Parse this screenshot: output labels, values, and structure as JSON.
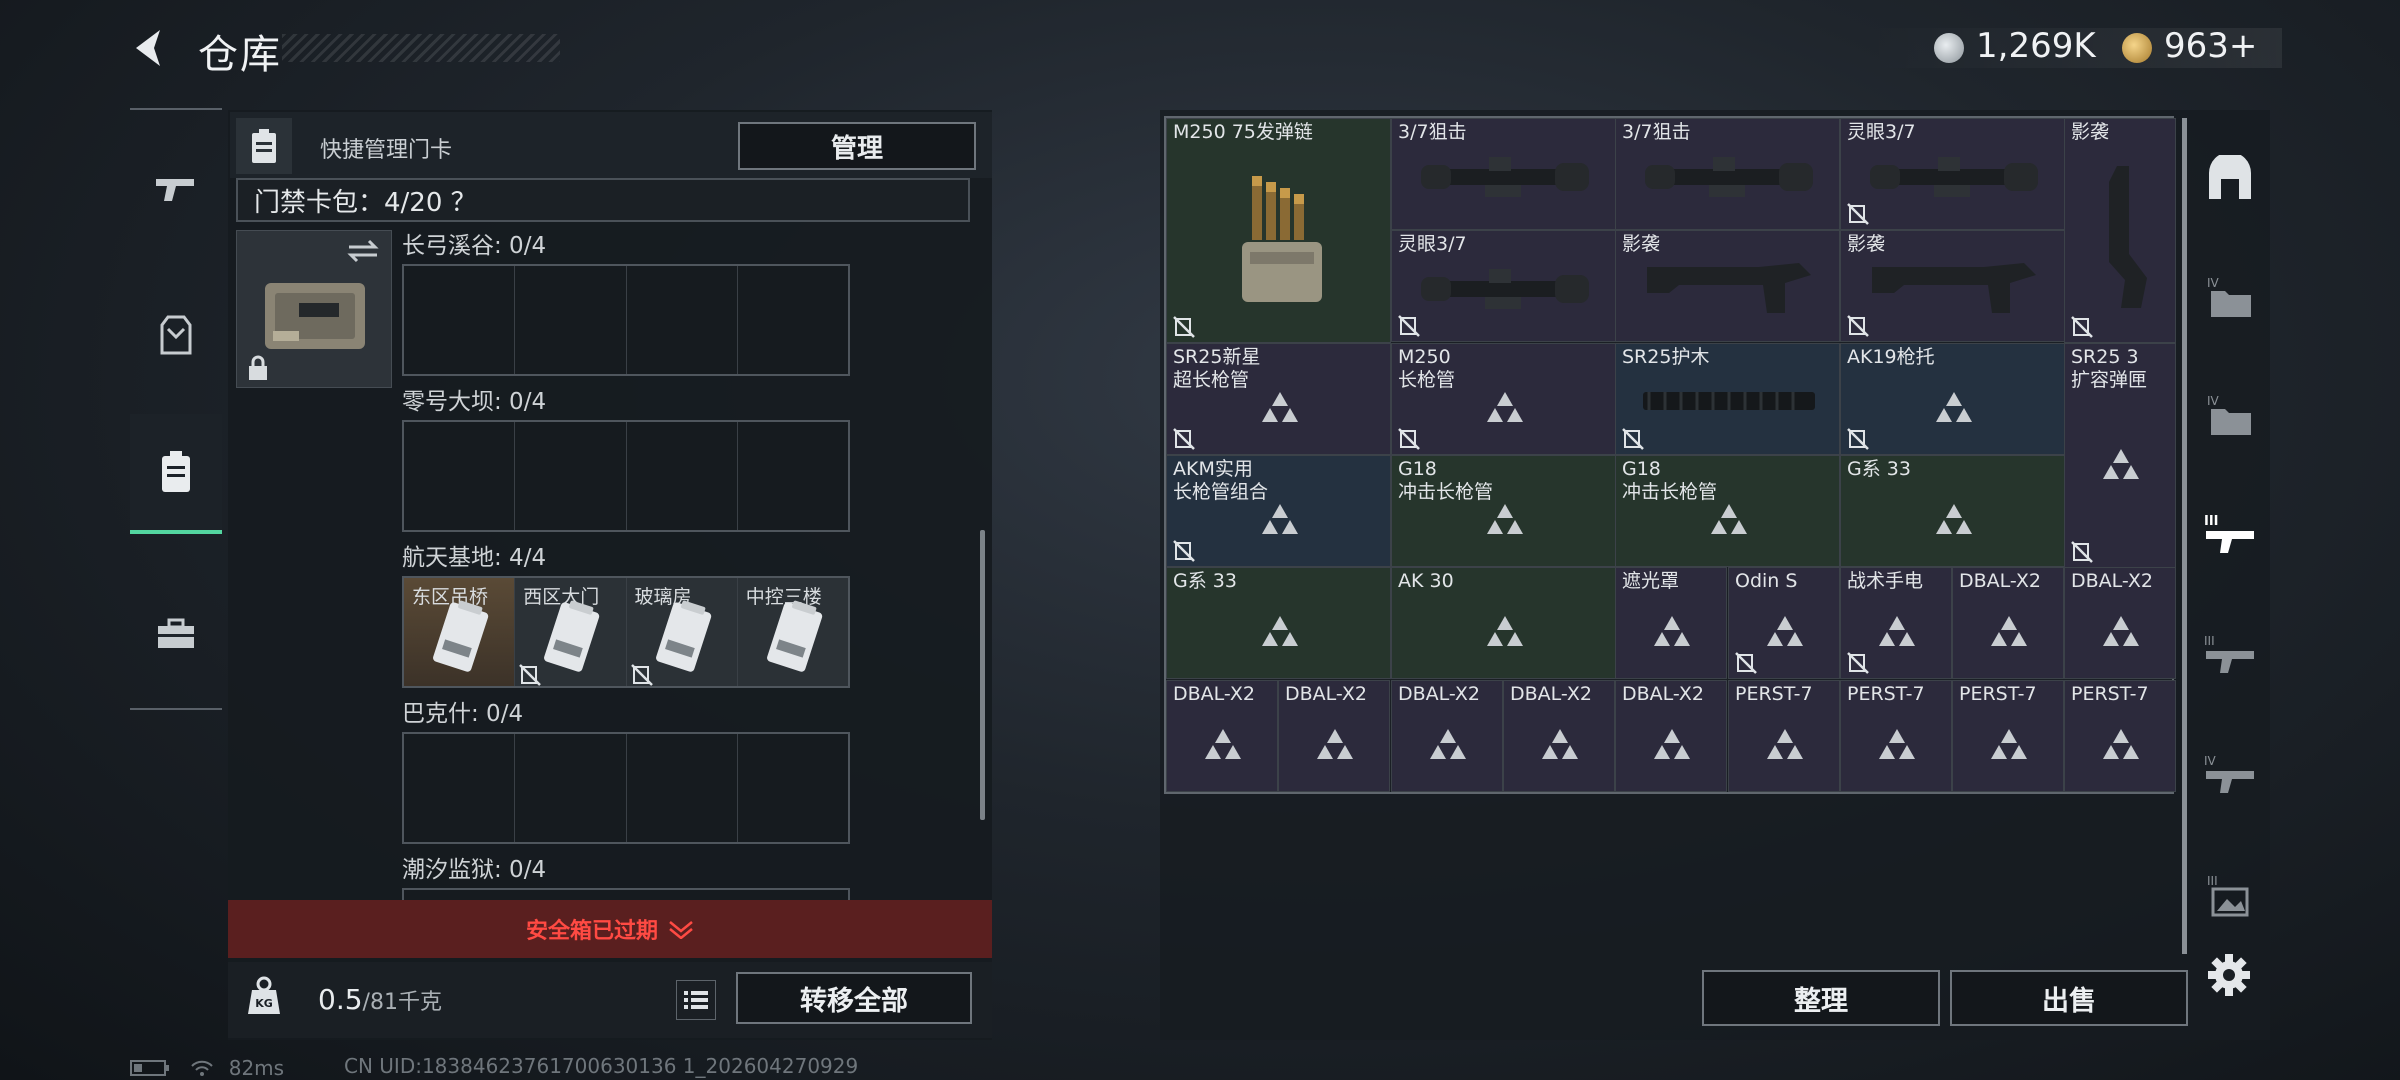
{
  "header": {
    "title": "仓库"
  },
  "currency": [
    {
      "icon": "silver-coin-icon",
      "value": "1,269K"
    },
    {
      "icon": "gold-coin-icon",
      "value": "963+"
    }
  ],
  "left_tabs": [
    {
      "icon": "gun-icon",
      "active": false
    },
    {
      "icon": "armor-icon",
      "active": false
    },
    {
      "icon": "keycard-icon",
      "active": true
    },
    {
      "icon": "toolbox-icon",
      "active": false
    }
  ],
  "keycard_panel": {
    "quick_label": "快捷管理门卡",
    "manage_label": "管理",
    "pack_label": "门禁卡包：4/20 ？",
    "regions": [
      {
        "label": "长弓溪谷: 0/4",
        "cards": []
      },
      {
        "label": "零号大坝: 0/4",
        "cards": []
      },
      {
        "label": "航天基地: 4/4",
        "cards": [
          "东区吊桥",
          "西区大门",
          "玻璃房",
          "中控三楼"
        ]
      },
      {
        "label": "巴克什: 0/4",
        "cards": []
      },
      {
        "label": "潮汐监狱: 0/4",
        "cards": []
      }
    ],
    "expired_label": "安全箱已过期",
    "weight_value": "0.5",
    "weight_max": "/81千克",
    "transfer_label": "转移全部"
  },
  "stash_items": [
    {
      "name": "M250 75发弹链"
    },
    {
      "name": "3/7狙击"
    },
    {
      "name": "3/7狙击"
    },
    {
      "name": "灵眼3/7"
    },
    {
      "name": "影袭"
    },
    {
      "name": "灵眼3/7"
    },
    {
      "name": "影袭"
    },
    {
      "name": "影袭"
    },
    {
      "name": "SR25新星\n超长枪管"
    },
    {
      "name": "M250\n长枪管"
    },
    {
      "name": "SR25护木"
    },
    {
      "name": "AK19枪托"
    },
    {
      "name": "SR25 3\n扩容弹匣"
    },
    {
      "name": "AKM实用\n长枪管组合"
    },
    {
      "name": "G18\n冲击长枪管"
    },
    {
      "name": "G18\n冲击长枪管"
    },
    {
      "name": "G系 33"
    },
    {
      "name": "G系 33"
    },
    {
      "name": "AK 30"
    },
    {
      "name": "遮光罩"
    },
    {
      "name": "Odin S"
    },
    {
      "name": "战术手电"
    },
    {
      "name": "DBAL-X2"
    },
    {
      "name": "DBAL-X2"
    },
    {
      "name": "DBAL-X2"
    },
    {
      "name": "DBAL-X2"
    },
    {
      "name": "DBAL-X2"
    },
    {
      "name": "DBAL-X2"
    },
    {
      "name": "DBAL-X2"
    },
    {
      "name": "PERST-7"
    },
    {
      "name": "PERST-7"
    },
    {
      "name": "PERST-7"
    },
    {
      "name": "PERST-7"
    }
  ],
  "actions": {
    "sort_label": "整理",
    "sell_label": "出售"
  },
  "status": {
    "ping": "82ms",
    "uid": "CN UID:18384623761700630136 1_202604270929"
  },
  "colors": {
    "accent": "#53d6a0",
    "danger": "#ff4a43",
    "rarity_green": "#26352c",
    "rarity_blue": "#243140",
    "rarity_purple": "#2c2a3c"
  }
}
